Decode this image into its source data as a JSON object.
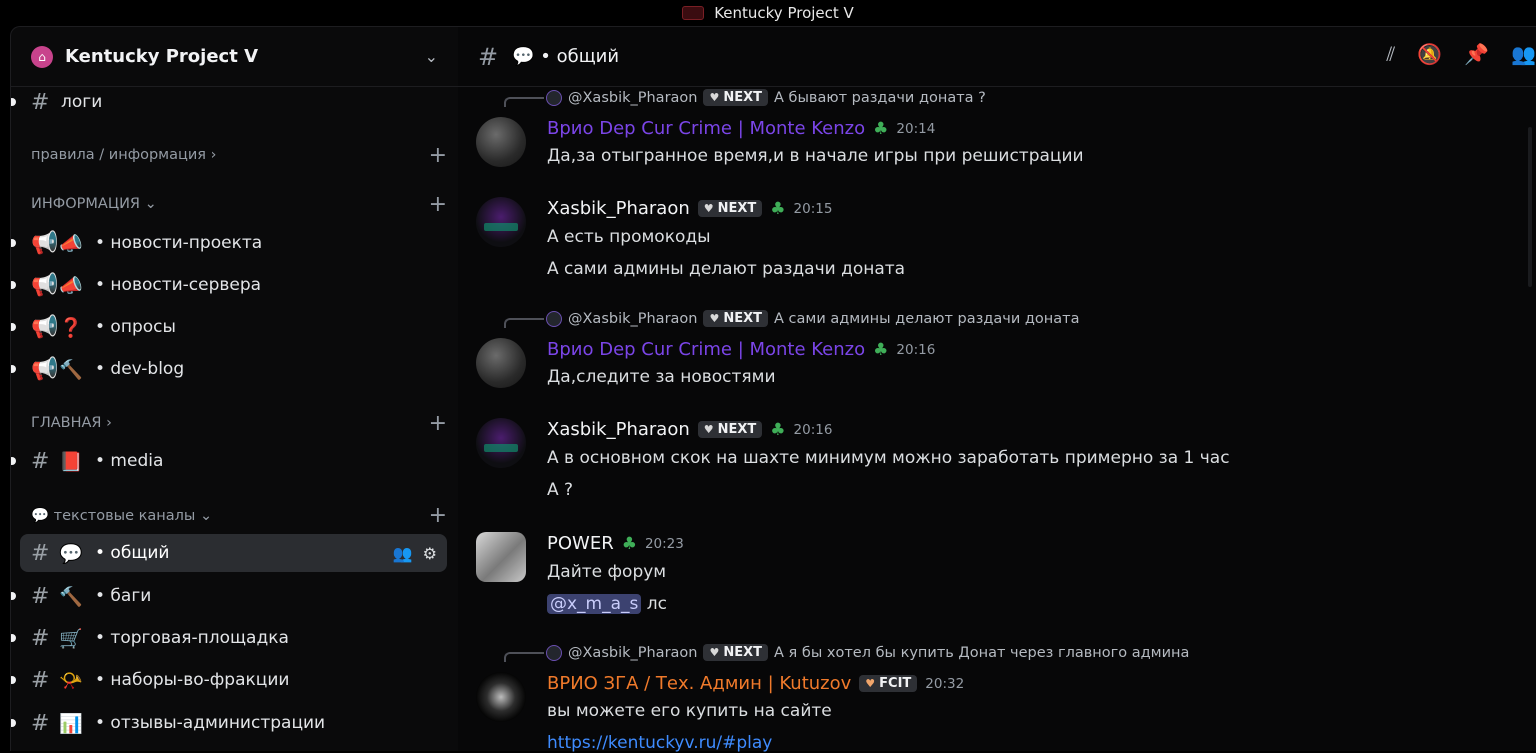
{
  "window": {
    "title": "Kentucky Project V"
  },
  "server": {
    "name": "Kentucky Project V"
  },
  "channel": {
    "current": "💬 • общий"
  },
  "sidebar": {
    "top_channel": {
      "label": "логи"
    },
    "categories": [
      {
        "label": "правила / информация ›"
      },
      {
        "label": "ИНФОРМАЦИЯ ⌄"
      },
      {
        "label": "ГЛАВНАЯ ›"
      },
      {
        "label": "💬 текстовые каналы ⌄"
      }
    ],
    "channels": [
      {
        "emoji": "📣",
        "label": "• новости-проекта"
      },
      {
        "emoji": "📣",
        "label": "• новости-сервера"
      },
      {
        "emoji": "❓",
        "label": "• опросы"
      },
      {
        "emoji": "🔨",
        "label": "• dev-blog"
      },
      {
        "emoji": "📕",
        "label": "• media"
      },
      {
        "emoji": "💬",
        "label": "• общий"
      },
      {
        "emoji": "🔨",
        "label": "• баги"
      },
      {
        "emoji": "🛒",
        "label": "• торговая-площадка"
      },
      {
        "emoji": "📯",
        "label": "• наборы-во-фракции"
      },
      {
        "emoji": "📊",
        "label": "• отзывы-администрации"
      }
    ]
  },
  "messages": [
    {
      "reply_to": "@Xasbik_Pharaon",
      "reply_tag": "NEXT",
      "reply_text": "А бывают раздачи доната ?",
      "author": "Врио Dep Cur Crime | Monte Kenzo",
      "time": "20:14",
      "lines": [
        "Да,за отыгранное время,и в начале игры при решистрации"
      ]
    },
    {
      "author": "Xasbik_Pharaon",
      "tag": "NEXT",
      "time": "20:15",
      "lines": [
        "А есть промокоды",
        "А сами админы делают раздачи доната"
      ]
    },
    {
      "reply_to": "@Xasbik_Pharaon",
      "reply_tag": "NEXT",
      "reply_text": "А сами админы делают раздачи доната",
      "author": "Врио Dep Cur Crime | Monte Kenzo",
      "time": "20:16",
      "lines": [
        "Да,следите за новостями"
      ]
    },
    {
      "author": "Xasbik_Pharaon",
      "tag": "NEXT",
      "time": "20:16",
      "lines": [
        "А в основном скок на шахте минимум можно заработать примерно за 1 час",
        "А ?"
      ]
    },
    {
      "author": "POWER",
      "time": "20:23",
      "lines": [
        "Дайте форум"
      ],
      "mention": "@x_m_a_s",
      "mention_rest": " лс"
    },
    {
      "reply_to": "@Xasbik_Pharaon",
      "reply_tag": "NEXT",
      "reply_text": "А я бы хотел бы купить Донат через главного админа",
      "author": "ВРИО ЗГА / Тех. Админ | Kutuzov",
      "tag": "FCIT",
      "time": "20:32",
      "lines": [
        "вы можете его купить на сайте"
      ],
      "link": "https://kentuckyv.ru/#play"
    }
  ],
  "colors": {
    "purple_role": "#7b45e8",
    "orange_role": "#f07a2b",
    "link": "#3f8cff",
    "clover": "#3fae58"
  }
}
